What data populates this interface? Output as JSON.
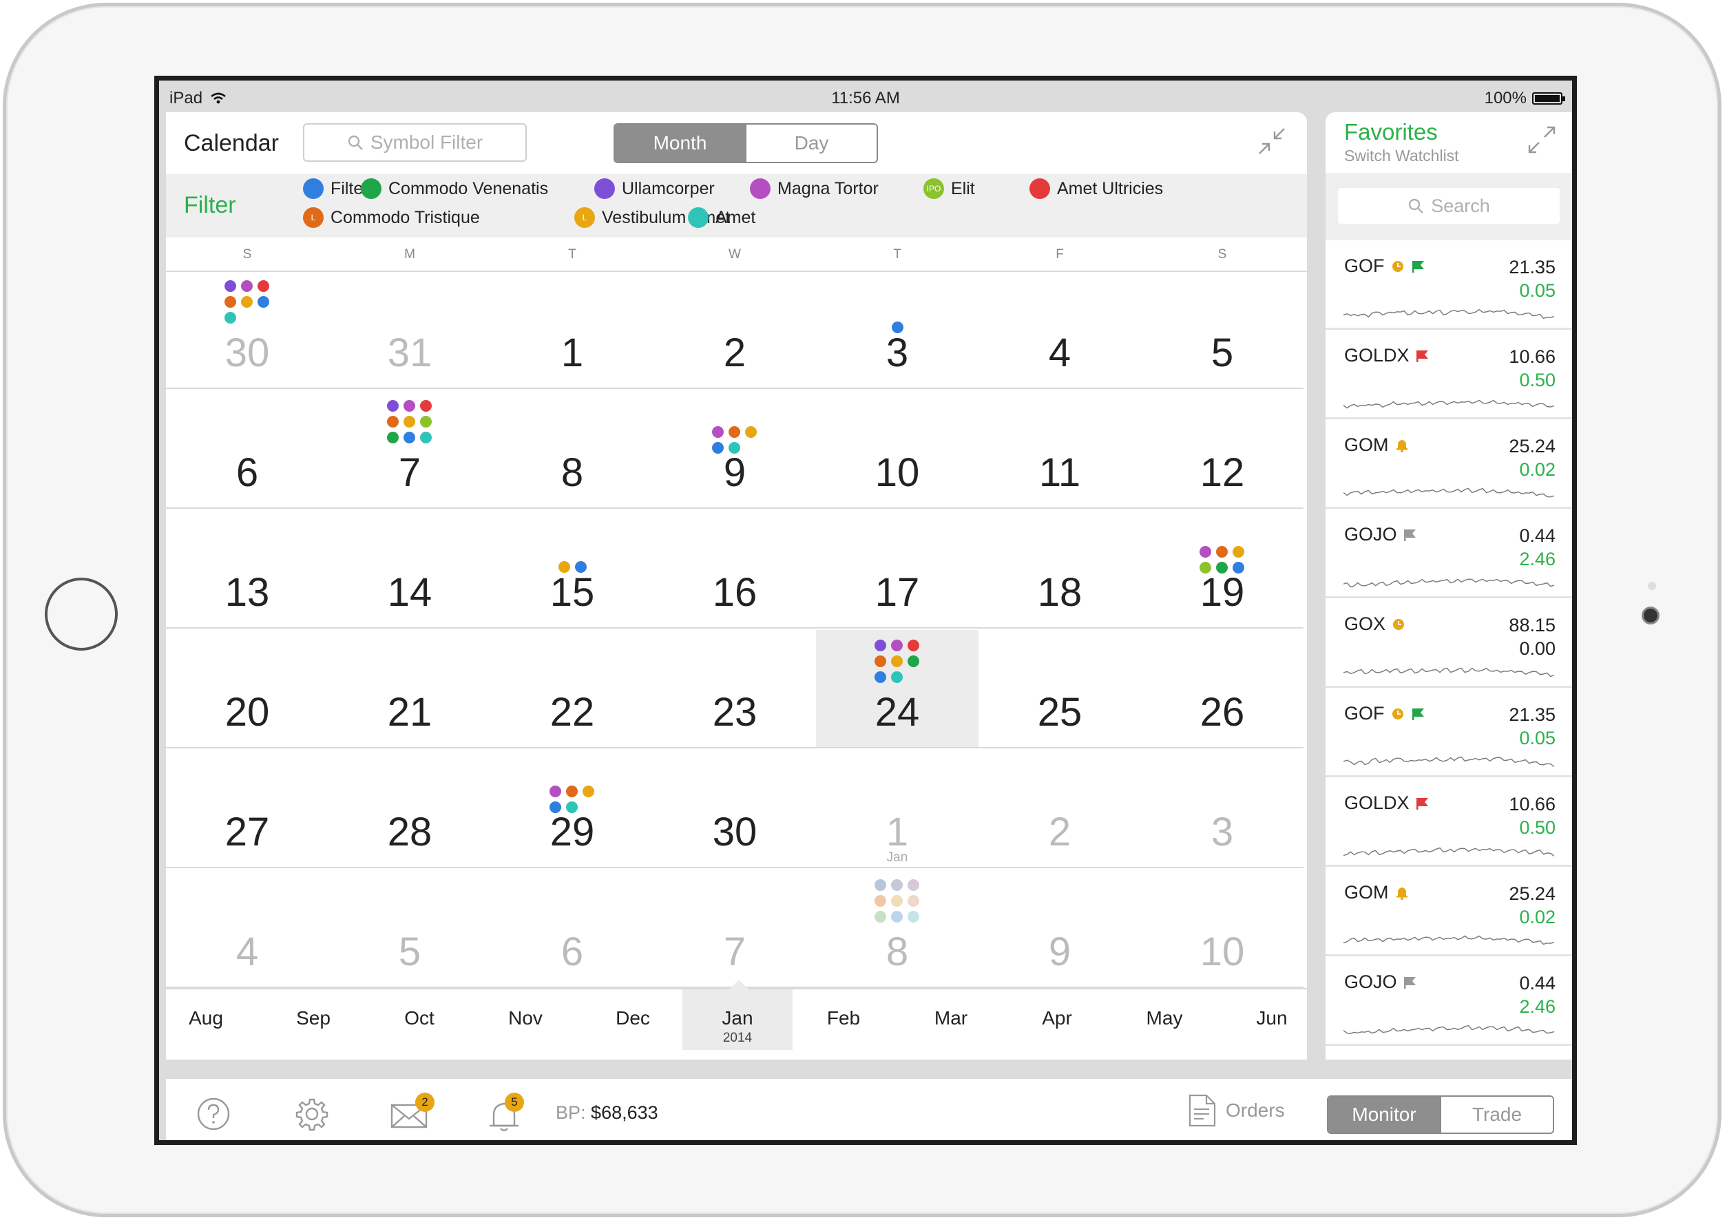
{
  "status": {
    "carrier": "iPad",
    "time": "11:56 AM",
    "battery": "100%"
  },
  "header": {
    "title": "Calendar",
    "symbol_filter_placeholder": "Symbol Filter",
    "view_month": "Month",
    "view_day": "Day"
  },
  "filter": {
    "label": "Filter",
    "chips": [
      {
        "label": "Filter",
        "color": "#2f7fe0",
        "icon": "lightbulb-icon"
      },
      {
        "label": "Commodo Venenatis",
        "color": "#1fa54a",
        "icon": "coins-icon"
      },
      {
        "label": "Ullamcorper",
        "color": "#7e4fd6",
        "icon": "document-icon"
      },
      {
        "label": "Magna Tortor",
        "color": "#b34fc1",
        "icon": "chart-line-icon"
      },
      {
        "label": "Elit",
        "color": "#8cc22b",
        "icon": "ipo-icon",
        "icon_text": "IPO"
      },
      {
        "label": "Amet Ultricies",
        "color": "#e53a3a",
        "icon": "phone-icon"
      },
      {
        "label": "Commodo Tristique",
        "color": "#e06a1a",
        "icon": "l-icon",
        "icon_text": "L"
      },
      {
        "label": "Vestibulum Amet",
        "color": "#e8a612",
        "icon": "l-icon",
        "icon_text": "L"
      },
      {
        "label": "Amet",
        "color": "#2ec4b8",
        "icon": "circle-icon"
      }
    ]
  },
  "weekdays": [
    "S",
    "M",
    "T",
    "W",
    "T",
    "F",
    "S"
  ],
  "calendar": {
    "weeks": [
      [
        {
          "d": "30",
          "dim": true
        },
        {
          "d": "31",
          "dim": true
        },
        {
          "d": "1"
        },
        {
          "d": "2"
        },
        {
          "d": "3"
        },
        {
          "d": "4"
        },
        {
          "d": "5"
        }
      ],
      [
        {
          "d": "6"
        },
        {
          "d": "7"
        },
        {
          "d": "8"
        },
        {
          "d": "9"
        },
        {
          "d": "10"
        },
        {
          "d": "11"
        },
        {
          "d": "12"
        }
      ],
      [
        {
          "d": "13"
        },
        {
          "d": "14"
        },
        {
          "d": "15"
        },
        {
          "d": "16"
        },
        {
          "d": "17"
        },
        {
          "d": "18"
        },
        {
          "d": "19"
        }
      ],
      [
        {
          "d": "20"
        },
        {
          "d": "21"
        },
        {
          "d": "22"
        },
        {
          "d": "23"
        },
        {
          "d": "24",
          "selected": true
        },
        {
          "d": "25"
        },
        {
          "d": "26"
        }
      ],
      [
        {
          "d": "27"
        },
        {
          "d": "28"
        },
        {
          "d": "29"
        },
        {
          "d": "30"
        },
        {
          "d": "1",
          "dim": true,
          "sub": "Jan"
        },
        {
          "d": "2",
          "dim": true
        },
        {
          "d": "3",
          "dim": true
        }
      ],
      [
        {
          "d": "4",
          "dim": true
        },
        {
          "d": "5",
          "dim": true
        },
        {
          "d": "6",
          "dim": true
        },
        {
          "d": "7",
          "dim": true
        },
        {
          "d": "8",
          "dim": true
        },
        {
          "d": "9",
          "dim": true
        },
        {
          "d": "10",
          "dim": true
        }
      ]
    ],
    "events": [
      {
        "week": 0,
        "day": 0,
        "colors": [
          "#7e4fd6",
          "#b34fc1",
          "#e53a3a",
          "#e06a1a",
          "#e8a612",
          "#2f7fe0",
          "#2ec4b8"
        ]
      },
      {
        "week": 0,
        "day": 4,
        "colors": [
          "#2f7fe0"
        ]
      },
      {
        "week": 1,
        "day": 1,
        "colors": [
          "#7e4fd6",
          "#b34fc1",
          "#e53a3a",
          "#e06a1a",
          "#e8a612",
          "#8cc22b",
          "#1fa54a",
          "#2f7fe0",
          "#2ec4b8"
        ]
      },
      {
        "week": 1,
        "day": 3,
        "colors": [
          "#b34fc1",
          "#e06a1a",
          "#e8a612",
          "#2f7fe0",
          "#2ec4b8"
        ]
      },
      {
        "week": 2,
        "day": 2,
        "colors": [
          "#e8a612",
          "#2f7fe0"
        ]
      },
      {
        "week": 2,
        "day": 6,
        "colors": [
          "#b34fc1",
          "#e06a1a",
          "#e8a612",
          "#8cc22b",
          "#1fa54a",
          "#2f7fe0"
        ]
      },
      {
        "week": 3,
        "day": 4,
        "colors": [
          "#7e4fd6",
          "#b34fc1",
          "#e53a3a",
          "#e06a1a",
          "#e8a612",
          "#1fa54a",
          "#2f7fe0",
          "#2ec4b8"
        ]
      },
      {
        "week": 4,
        "day": 2,
        "colors": [
          "#b34fc1",
          "#e06a1a",
          "#e8a612",
          "#2f7fe0",
          "#2ec4b8"
        ]
      },
      {
        "week": 5,
        "day": 4,
        "faded": true,
        "colors": [
          "#b8c6dc",
          "#c8c8d8",
          "#d8c8d8",
          "#f0c8a8",
          "#f0dcb8",
          "#f0d8c8",
          "#c8e0c8",
          "#bcd4ec",
          "#c4e4e8"
        ]
      }
    ]
  },
  "months": [
    {
      "label": "Aug"
    },
    {
      "label": "Sep"
    },
    {
      "label": "Oct"
    },
    {
      "label": "Nov"
    },
    {
      "label": "Dec"
    },
    {
      "label": "Jan",
      "year": "2014",
      "selected": true
    },
    {
      "label": "Feb"
    },
    {
      "label": "Mar"
    },
    {
      "label": "Apr"
    },
    {
      "label": "May"
    },
    {
      "label": "Jun"
    }
  ],
  "watchlist": {
    "title": "Favorites",
    "subtitle": "Switch Watchlist",
    "search_placeholder": "Search",
    "items": [
      {
        "symbol": "GOF",
        "icons": [
          "clock-icon",
          "flag-icon"
        ],
        "flag_color": "#1fa54a",
        "price": "21.35",
        "change": "0.05"
      },
      {
        "symbol": "GOLDX",
        "icons": [
          "flag-icon"
        ],
        "flag_color": "#e53a3a",
        "price": "10.66",
        "change": "0.50"
      },
      {
        "symbol": "GOM",
        "icons": [
          "bell-icon"
        ],
        "flag_color": "",
        "price": "25.24",
        "change": "0.02"
      },
      {
        "symbol": "GOJO",
        "icons": [
          "flag-icon"
        ],
        "flag_color": "#999999",
        "price": "0.44",
        "change": "2.46"
      },
      {
        "symbol": "GOX",
        "icons": [
          "clock-icon"
        ],
        "flag_color": "",
        "price": "88.15",
        "change": "0.00"
      },
      {
        "symbol": "GOF",
        "icons": [
          "clock-icon",
          "flag-icon"
        ],
        "flag_color": "#1fa54a",
        "price": "21.35",
        "change": "0.05"
      },
      {
        "symbol": "GOLDX",
        "icons": [
          "flag-icon"
        ],
        "flag_color": "#e53a3a",
        "price": "10.66",
        "change": "0.50"
      },
      {
        "symbol": "GOM",
        "icons": [
          "bell-icon"
        ],
        "flag_color": "",
        "price": "25.24",
        "change": "0.02"
      },
      {
        "symbol": "GOJO",
        "icons": [
          "flag-icon"
        ],
        "flag_color": "#999999",
        "price": "0.44",
        "change": "2.46"
      }
    ]
  },
  "toolbar": {
    "mail_badge": "2",
    "alerts_badge": "5",
    "bp_label": "BP:",
    "bp_value": "$68,633",
    "orders_label": "Orders",
    "mode_monitor": "Monitor",
    "mode_trade": "Trade"
  },
  "colors": {
    "accent_green": "#2bb14a",
    "badge": "#e8a612"
  }
}
